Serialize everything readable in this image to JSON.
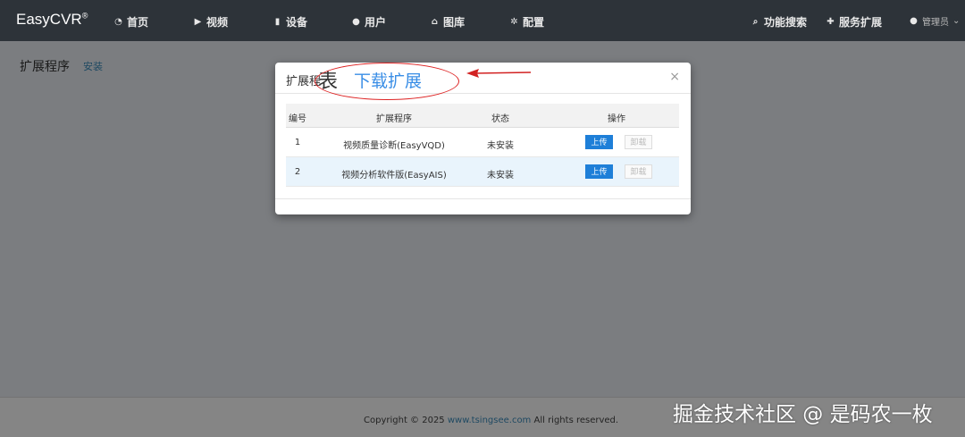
{
  "topbar": {
    "brand": "EasyCVR",
    "brand_mark": "®",
    "nav": [
      {
        "label": "首页",
        "icon": "dashboard-icon"
      },
      {
        "label": "视频",
        "icon": "play-icon"
      },
      {
        "label": "设备",
        "icon": "device-icon"
      },
      {
        "label": "用户",
        "icon": "user-icon"
      },
      {
        "label": "图库",
        "icon": "bank-icon"
      },
      {
        "label": "配置",
        "icon": "gear-icon"
      }
    ],
    "search": {
      "label": "功能搜索",
      "icon": "search-icon"
    },
    "extensions": {
      "label": "服务扩展",
      "icon": "puzzle-icon"
    },
    "user": {
      "label": "管理员",
      "icon": "user-icon"
    }
  },
  "page": {
    "title": "扩展程序",
    "install_link": "安装"
  },
  "modal": {
    "title": "扩展程",
    "close": "×",
    "columns": [
      "编号",
      "扩展程序",
      "状态",
      "操作"
    ],
    "rows": [
      {
        "id": "1",
        "name": "视频质量诊断(EasyVQD)",
        "status": "未安装",
        "upload": "上传",
        "uninstall": "卸载"
      },
      {
        "id": "2",
        "name": "视频分析软件版(EasyAIS)",
        "status": "未安装",
        "upload": "上传",
        "uninstall": "卸载"
      }
    ]
  },
  "annotation": {
    "char": "表",
    "text": "下载扩展",
    "color": "#d22222"
  },
  "footer": {
    "prefix": "Copyright © 2025 ",
    "link": "www.tsingsee.com",
    "suffix": " All rights reserved."
  },
  "watermark": "掘金技术社区 @ 是码农一枚"
}
